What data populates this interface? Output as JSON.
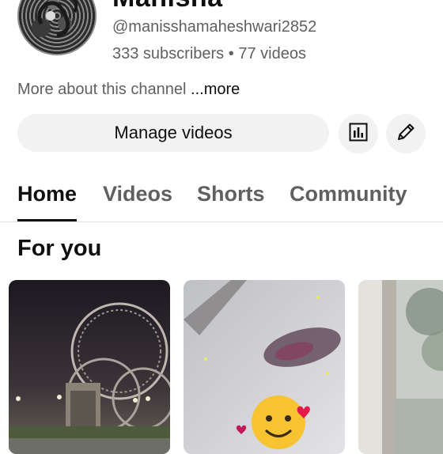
{
  "channel": {
    "name": "Manisha",
    "handle": "@manisshamaheshwari2852",
    "subscribers": "333 subscribers",
    "separator": "•",
    "videos": "77 videos",
    "about_text": "More about this channel ",
    "about_more": "...more"
  },
  "actions": {
    "manage_videos_label": "Manage videos",
    "analytics_icon": "analytics-icon",
    "edit_icon": "pencil-icon"
  },
  "tabs": [
    {
      "label": "Home",
      "active": true
    },
    {
      "label": "Videos",
      "active": false
    },
    {
      "label": "Shorts",
      "active": false
    },
    {
      "label": "Community",
      "active": false
    }
  ],
  "section": {
    "title": "For you"
  },
  "thumbnails": [
    {
      "name": "video-thumbnail-night-ferris-wheel"
    },
    {
      "name": "video-thumbnail-emoji-short"
    },
    {
      "name": "video-thumbnail-partial"
    }
  ],
  "colors": {
    "text_primary": "#0f0f0f",
    "text_secondary": "#606060",
    "button_bg": "#f2f2f2"
  }
}
